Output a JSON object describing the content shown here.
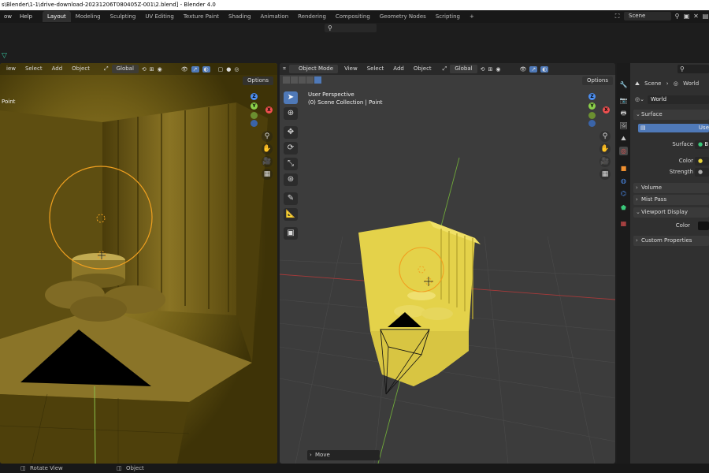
{
  "window": {
    "title": "s\\Blender\\1-1\\drive-download-20231206T080405Z-001\\2.blend] - Blender 4.0"
  },
  "menus": [
    "ow",
    "Help"
  ],
  "workspaces": [
    "Layout",
    "Modeling",
    "Sculpting",
    "UV Editing",
    "Texture Paint",
    "Shading",
    "Animation",
    "Rendering",
    "Compositing",
    "Geometry Nodes",
    "Scripting"
  ],
  "active_workspace": "Layout",
  "scene_selector": {
    "value": "Scene"
  },
  "left_viewport": {
    "menus": [
      "iew",
      "Select",
      "Add",
      "Object"
    ],
    "orientation": "Global",
    "options_label": "Options",
    "object_label": "Point"
  },
  "right_viewport": {
    "mode": "Object Mode",
    "menus": [
      "View",
      "Select",
      "Add",
      "Object"
    ],
    "orientation": "Global",
    "options_label": "Options",
    "perspective_label": "User Perspective",
    "collection_label": "(0) Scene Collection | Point",
    "last_operator": "Move"
  },
  "gizmo_labels": {
    "x": "X",
    "y": "Y",
    "z": "Z"
  },
  "properties": {
    "breadcrumb_scene": "Scene",
    "breadcrumb_world": "World",
    "world_name": "World",
    "surface_header": "Surface",
    "use_nodes_button": "Use",
    "surface_label": "Surface",
    "surface_value": "B",
    "color_label": "Color",
    "strength_label": "Strength",
    "volume_header": "Volume",
    "mist_header": "Mist Pass",
    "viewport_display_header": "Viewport Display",
    "vd_color_label": "Color",
    "custom_props_header": "Custom Properties"
  },
  "status_bar": {
    "rotate_view": "Rotate View",
    "object": "Object"
  },
  "colors": {
    "accent": "#4f79b8",
    "light_ring": "#f0a020",
    "mesh_yellow": "#e4d24a"
  }
}
